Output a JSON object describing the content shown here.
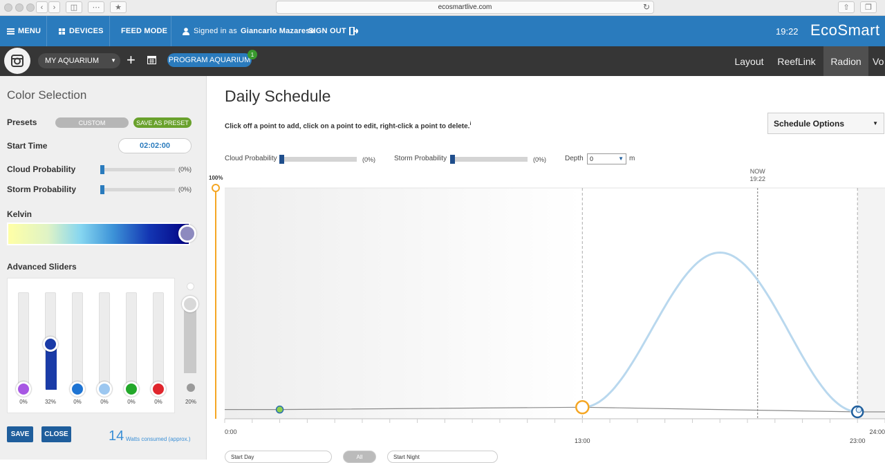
{
  "browser": {
    "url": "ecosmartlive.com",
    "icons": [
      "back-icon",
      "forward-icon",
      "sidebar-icon",
      "grid-icon",
      "star-icon",
      "reload-icon",
      "share-icon",
      "tabs-icon"
    ]
  },
  "topnav": {
    "menu_label": "MENU",
    "devices_label": "DEVICES",
    "feed_mode_label": "FEED MODE",
    "signed_in_prefix": "Signed in as",
    "user_name": "Giancarlo Mazarese",
    "sign_out_label": "SIGN OUT",
    "clock": "19:22",
    "brand": "EcoSmart L",
    "color": "#2a7bbd"
  },
  "toolbar": {
    "aquarium": "MY AQUARIUM",
    "program_label": "PROGRAM AQUARIUM",
    "program_badge": "1",
    "tabs": [
      "Layout",
      "ReefLink",
      "Radion",
      "Vo"
    ],
    "active_tab": "Radion"
  },
  "color_selection": {
    "title": "Color Selection",
    "presets_label": "Presets",
    "preset_value": "CUSTOM",
    "save_preset_label": "SAVE AS PRESET",
    "start_time_label": "Start Time",
    "start_time": "02:02:00",
    "cloud_label": "Cloud Probability",
    "cloud_pct": "(0%)",
    "storm_label": "Storm Probability",
    "storm_pct": "(0%)",
    "kelvin_label": "Kelvin",
    "advanced_label": "Advanced Sliders",
    "channels": [
      {
        "pct": "0%",
        "value": 0,
        "color": "#a757e3"
      },
      {
        "pct": "32%",
        "value": 32,
        "color": "#1a3ba7"
      },
      {
        "pct": "0%",
        "value": 0,
        "color": "#1e74d3"
      },
      {
        "pct": "0%",
        "value": 0,
        "color": "#9cc7f0"
      },
      {
        "pct": "0%",
        "value": 0,
        "color": "#23a82a"
      },
      {
        "pct": "0%",
        "value": 0,
        "color": "#e0262d"
      }
    ],
    "master_pct": "20%",
    "save_label": "SAVE",
    "close_label": "CLOSE",
    "watts": "14",
    "watts_label": "Watts consumed (approx.)"
  },
  "schedule": {
    "title": "Daily Schedule",
    "instructions": "Click off a point to add, click on a point to edit, right-click a point to delete.",
    "options_label": "Schedule Options",
    "cloud_label": "Cloud Probability",
    "cloud_pct": "(0%)",
    "storm_label": "Storm Probability",
    "storm_pct": "(0%)",
    "depth_label": "Depth",
    "depth_value": "0",
    "depth_unit": "m",
    "bottom": {
      "start_day": "Start Day",
      "start_night": "Start Night",
      "center": "All"
    }
  },
  "chart_data": {
    "type": "line",
    "y_top_label": "100%",
    "ylim": [
      0,
      100
    ],
    "x_tick_labels": [
      "0:00",
      "13:00",
      "23:00",
      "24:00"
    ],
    "now_label": "NOW",
    "now_time": "19:22",
    "now_hours": 19.37,
    "dashed_markers_hours": [
      13.0,
      23.0
    ],
    "points": [
      {
        "x": 2.0,
        "y": 4,
        "kind": "green"
      },
      {
        "x": 13.0,
        "y": 5,
        "kind": "selected"
      },
      {
        "x": 23.0,
        "y": 3,
        "kind": "blue"
      }
    ],
    "curve": {
      "start_hours": 13.0,
      "peak_hours": 18.0,
      "end_hours": 23.0,
      "peak_y": 72,
      "color": "#b9d8ee"
    }
  }
}
